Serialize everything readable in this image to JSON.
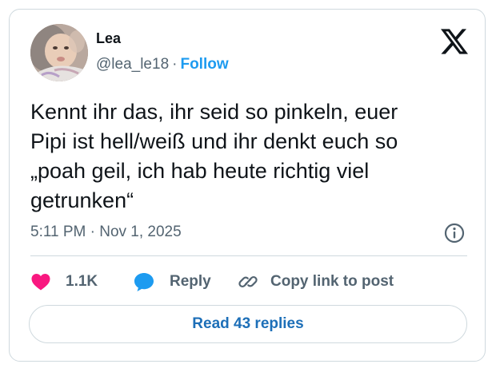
{
  "author": {
    "name": "Lea",
    "handle": "@lea_le18",
    "separator": "·",
    "follow_label": "Follow",
    "avatar_icon": "baby-photo-avatar"
  },
  "brand": {
    "logo_icon": "x-logo-icon"
  },
  "tweet": {
    "text": "Kennt ihr das, ihr seid so pinkeln, euer\nPipi ist hell/weiß und ihr denkt euch so\n„poah geil, ich hab heute richtig viel\ngetrunken“",
    "timestamp": "5:11 PM · Nov 1, 2025",
    "info_icon": "info-icon"
  },
  "actions": {
    "likes": "1.1K",
    "reply_label": "Reply",
    "copy_link_label": "Copy link to post"
  },
  "read_replies_label": "Read 43 replies",
  "colors": {
    "accent": "#1d9bf0",
    "like": "#f91880",
    "reply_bubble": "#1d9bf0",
    "muted_text": "#536471",
    "border": "#cfd9de"
  }
}
